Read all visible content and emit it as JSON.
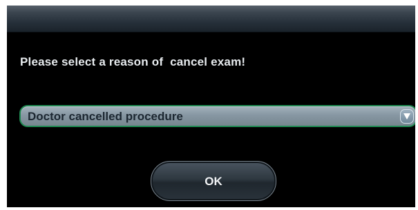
{
  "dialog": {
    "prompt": "Please select a reason of  cancel exam!",
    "reason_select": {
      "selected": "Doctor cancelled procedure",
      "arrow_icon": "chevron-down-icon"
    },
    "ok_label": "OK"
  },
  "colors": {
    "dialog_background": "#000000",
    "select_border": "#1f8a52",
    "text": "#e8ecef"
  }
}
